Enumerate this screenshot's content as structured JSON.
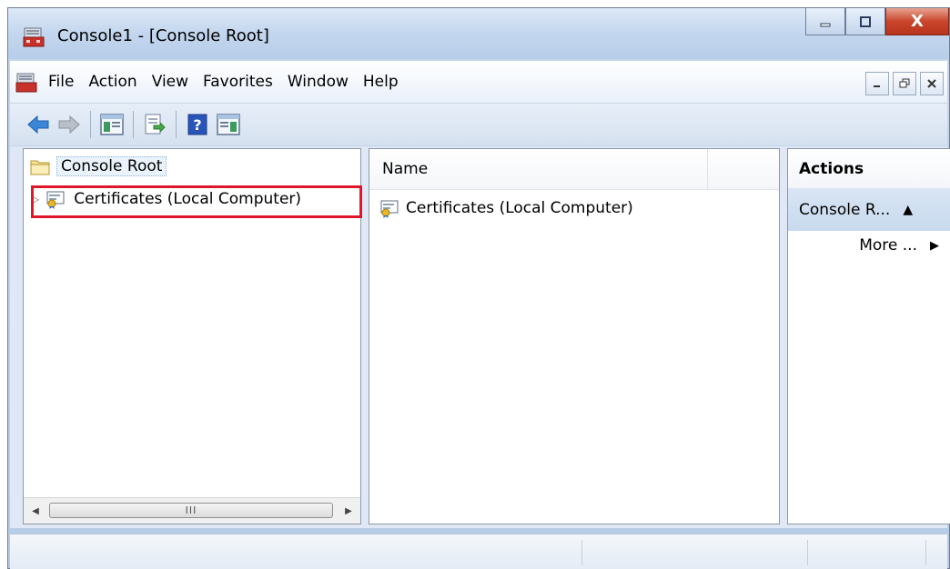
{
  "window": {
    "title": "Console1 - [Console Root]",
    "close_glyph": "X"
  },
  "menubar": {
    "items": [
      "File",
      "Action",
      "View",
      "Favorites",
      "Window",
      "Help"
    ]
  },
  "toolbar": {
    "buttons": [
      "back-arrow-icon",
      "forward-arrow-icon",
      "show-hide-console-tree-icon",
      "export-list-icon",
      "help-icon",
      "show-hide-action-pane-icon"
    ]
  },
  "tree": {
    "root_label": "Console Root",
    "items": [
      {
        "label": "Certificates (Local Computer)",
        "expander": "▷"
      }
    ],
    "scroll_grip": "III"
  },
  "list": {
    "column_name": "Name",
    "rows": [
      {
        "name": "Certificates (Local Computer)"
      }
    ]
  },
  "actions": {
    "header": "Actions",
    "section_title": "Console R...",
    "section_arrow": "▲",
    "more_label": "More ...",
    "more_arrow": "▶"
  },
  "colors": {
    "highlight": "#e0162b",
    "accent": "#1c6fd0"
  }
}
